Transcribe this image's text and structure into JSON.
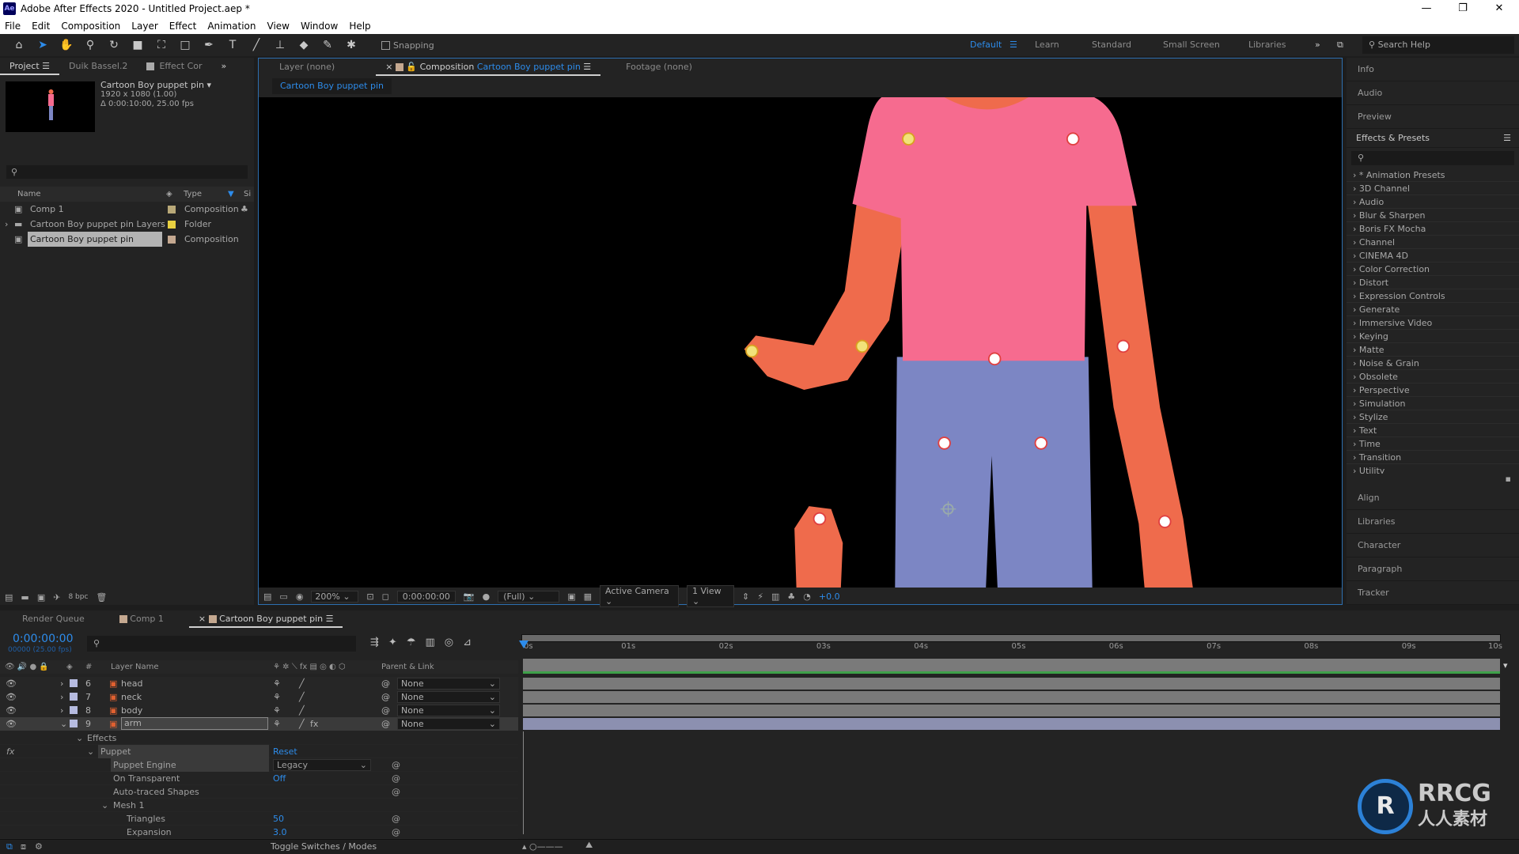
{
  "app": {
    "title": "Adobe After Effects 2020 - Untitled Project.aep *",
    "logo": "Ae",
    "window_controls": [
      "minimize-icon",
      "restore-icon",
      "close-icon"
    ]
  },
  "menu": [
    "File",
    "Edit",
    "Composition",
    "Layer",
    "Effect",
    "Animation",
    "View",
    "Window",
    "Help"
  ],
  "toolbar": {
    "snapping": "Snapping",
    "workspaces": [
      "Default",
      "Learn",
      "Standard",
      "Small Screen",
      "Libraries"
    ],
    "active_workspace": "Default",
    "search_help": "Search Help"
  },
  "project": {
    "tabs": [
      "Project",
      "Duik Bassel.2",
      "Effect Cor"
    ],
    "comp_name": "Cartoon Boy puppet pin",
    "comp_size": "1920 x 1080 (1.00)",
    "comp_duration": "Δ 0:00:10:00, 25.00 fps",
    "columns": [
      "Name",
      "Type",
      "Si"
    ],
    "items": [
      {
        "name": "Comp 1",
        "type": "Composition",
        "color": "#b8a878"
      },
      {
        "name": "Cartoon Boy puppet pin Layers",
        "type": "Folder",
        "color": "#e8d040"
      },
      {
        "name": "Cartoon Boy puppet pin",
        "type": "Composition",
        "color": "#c4a890",
        "selected": true
      }
    ],
    "bpc": "8 bpc"
  },
  "comp": {
    "tabs": {
      "layer": "Layer (none)",
      "comp_prefix": "Composition",
      "comp_name": "Cartoon Boy puppet pin",
      "footage": "Footage (none)"
    },
    "breadcrumb": "Cartoon Boy puppet pin",
    "footer": {
      "zoom": "200%",
      "timecode": "0:00:00:00",
      "resolution": "(Full)",
      "camera": "Active Camera",
      "views": "1 View",
      "exposure": "+0.0"
    },
    "colors": {
      "shirt": "#f66b8f",
      "skin": "#ef6b4c",
      "pants": "#7c86c4",
      "pin_yellow": "#f2e27a",
      "pin_white": "#ffffff"
    }
  },
  "right": {
    "panels_top": [
      "Info",
      "Audio",
      "Preview"
    ],
    "effects_title": "Effects & Presets",
    "effects": [
      "* Animation Presets",
      "3D Channel",
      "Audio",
      "Blur & Sharpen",
      "Boris FX Mocha",
      "Channel",
      "CINEMA 4D",
      "Color Correction",
      "Distort",
      "Expression Controls",
      "Generate",
      "Immersive Video",
      "Keying",
      "Matte",
      "Noise & Grain",
      "Obsolete",
      "Perspective",
      "Simulation",
      "Stylize",
      "Text",
      "Time",
      "Transition",
      "Utility"
    ],
    "panels_bottom": [
      "Align",
      "Libraries",
      "Character",
      "Paragraph",
      "Tracker"
    ]
  },
  "timeline": {
    "tabs": [
      "Render Queue",
      "Comp 1",
      "Cartoon Boy puppet pin"
    ],
    "timecode": "0:00:00:00",
    "frame_info": "00000 (25.00 fps)",
    "header": {
      "hash": "#",
      "layer_name": "Layer Name",
      "parent": "Parent & Link"
    },
    "layers": [
      {
        "num": "6",
        "name": "head",
        "parent": "None"
      },
      {
        "num": "7",
        "name": "neck",
        "parent": "None"
      },
      {
        "num": "8",
        "name": "body",
        "parent": "None"
      },
      {
        "num": "9",
        "name": "arm",
        "parent": "None",
        "selected": true
      }
    ],
    "props": {
      "effects": "Effects",
      "puppet": "Puppet",
      "reset": "Reset",
      "engine_label": "Puppet Engine",
      "engine_value": "Legacy",
      "transparent_label": "On Transparent",
      "transparent_value": "Off",
      "auto_traced": "Auto-traced Shapes",
      "mesh": "Mesh 1",
      "triangles_label": "Triangles",
      "triangles_value": "50",
      "expansion_label": "Expansion",
      "expansion_value": "3.0"
    },
    "ruler": [
      "0s",
      "01s",
      "02s",
      "03s",
      "04s",
      "05s",
      "06s",
      "07s",
      "08s",
      "09s",
      "10s"
    ],
    "toggle": "Toggle Switches / Modes"
  },
  "watermark": {
    "brand": "RRCG",
    "sub": "人人素材"
  }
}
